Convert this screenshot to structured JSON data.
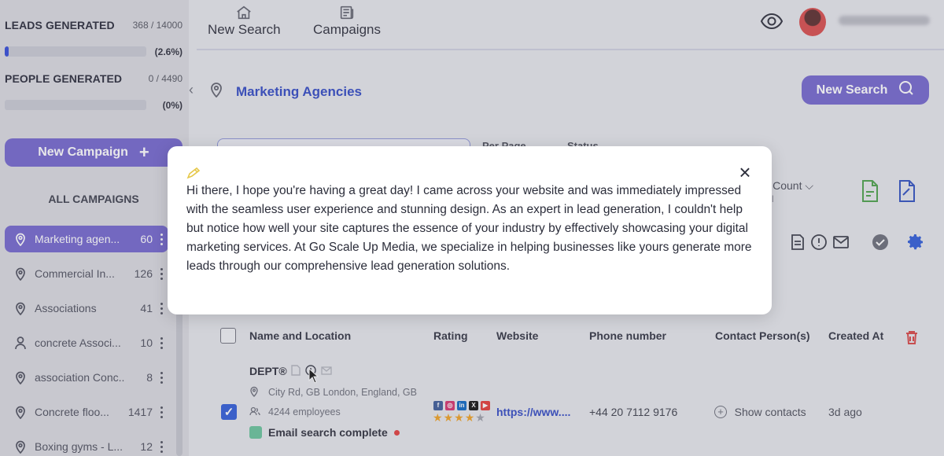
{
  "stats": {
    "leads": {
      "label": "LEADS GENERATED",
      "count": "368 / 14000",
      "percent_text": "(2.6%)",
      "fraction": 0.026
    },
    "people": {
      "label": "PEOPLE GENERATED",
      "count": "0 / 4490",
      "percent_text": "(0%)",
      "fraction": 0.0
    }
  },
  "sidebar": {
    "new_campaign_label": "New Campaign",
    "all_campaigns_label": "ALL CAMPAIGNS",
    "campaigns": [
      {
        "name": "Marketing agen...",
        "count": "60",
        "icon": "map-pin-icon",
        "active": true
      },
      {
        "name": "Commercial In...",
        "count": "126",
        "icon": "map-pin-icon",
        "active": false
      },
      {
        "name": "Associations",
        "count": "41",
        "icon": "map-pin-icon",
        "active": false
      },
      {
        "name": "concrete Associ...",
        "count": "10",
        "icon": "person-icon",
        "active": false
      },
      {
        "name": "association Conc...",
        "count": "8",
        "icon": "map-pin-icon",
        "active": false
      },
      {
        "name": "Concrete floo...",
        "count": "1417",
        "icon": "map-pin-icon",
        "active": false
      },
      {
        "name": "Boxing gyms - L...",
        "count": "12",
        "icon": "map-pin-icon",
        "active": false
      }
    ]
  },
  "nav": {
    "tabs": [
      {
        "label": "New Search",
        "icon": "home-icon"
      },
      {
        "label": "Campaigns",
        "icon": "newspaper-icon"
      }
    ]
  },
  "main": {
    "location_title": "Marketing Agencies",
    "new_search_label": "New Search",
    "per_page_label": "Per Page",
    "status_label": "Status",
    "emails_count_label": "ils Count",
    "emails_count_sub": "nail"
  },
  "table": {
    "columns": [
      "Name and Location",
      "Rating",
      "Website",
      "Phone number",
      "Contact Person(s)",
      "Created At"
    ],
    "rows": [
      {
        "name": "DEPT®",
        "address": "City Rd, GB London, England, GB",
        "employees": "4244 employees",
        "email_status": "Email search complete",
        "rating": 4,
        "website": "https://www....",
        "phone": "+44 20 7112 9176",
        "contacts": "Show contacts",
        "created": "3d ago",
        "checked": true
      }
    ]
  },
  "modal": {
    "message": "Hi there, I hope you're having a great day! I came across your website and was immediately impressed with the seamless user experience and stunning design. As an expert in lead generation, I couldn't help but notice how well your site captures the essence of your industry by effectively showcasing your digital marketing services. At Go Scale Up Media, we specialize in helping businesses like yours generate more leads through our comprehensive lead generation solutions."
  },
  "colors": {
    "accent": "#7264ce",
    "link": "#2f47c4",
    "progress": "#3049d8",
    "danger": "#d84444",
    "success": "#67c29a"
  }
}
